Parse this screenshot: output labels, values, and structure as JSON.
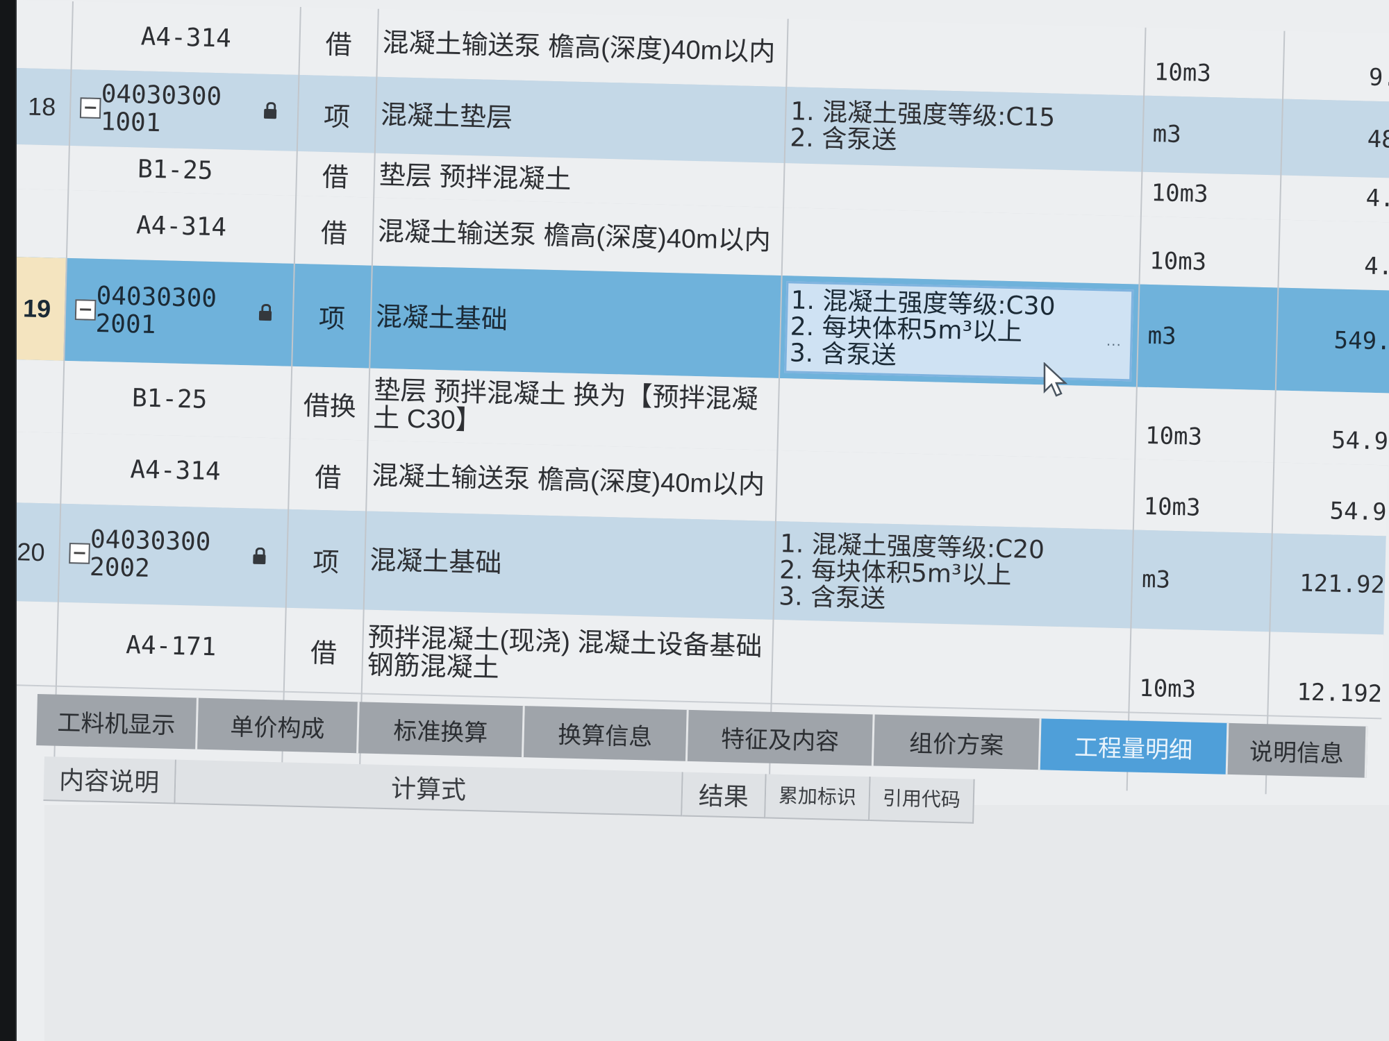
{
  "rows": [
    {
      "kind": "sub",
      "num": "",
      "code": "A4-314",
      "type": "借",
      "name": "混凝土输送泵 檐高(深度)40m以内",
      "features": "",
      "unit": "10m3",
      "qty": "9."
    },
    {
      "kind": "item",
      "num": "18",
      "code": "04030300\n1001",
      "type": "项",
      "name": "混凝土垫层",
      "features": "1. 混凝土强度等级:C15\n2. 含泵送",
      "unit": "m3",
      "qty": "48"
    },
    {
      "kind": "sub",
      "num": "",
      "code": "B1-25",
      "type": "借",
      "name": "垫层 预拌混凝土",
      "features": "",
      "unit": "10m3",
      "qty": "4."
    },
    {
      "kind": "sub",
      "num": "",
      "code": "A4-314",
      "type": "借",
      "name": "混凝土输送泵 檐高(深度)40m以内",
      "features": "",
      "unit": "10m3",
      "qty": "4."
    },
    {
      "kind": "sel",
      "num": "19",
      "code": "04030300\n2001",
      "type": "项",
      "name": "混凝土基础",
      "features": "1. 混凝土强度等级:C30\n2. 每块体积5m³以上\n3. 含泵送",
      "unit": "m3",
      "qty": "549."
    },
    {
      "kind": "sub",
      "num": "",
      "code": "B1-25",
      "type": "借换",
      "name": "垫层 预拌混凝土  换为【预拌混凝土 C30】",
      "features": "",
      "unit": "10m3",
      "qty": "54.9"
    },
    {
      "kind": "sub",
      "num": "",
      "code": "A4-314",
      "type": "借",
      "name": "混凝土输送泵 檐高(深度)40m以内",
      "features": "",
      "unit": "10m3",
      "qty": "54.9"
    },
    {
      "kind": "item",
      "num": "20",
      "code": "04030300\n2002",
      "type": "项",
      "name": "混凝土基础",
      "features": "1. 混凝土强度等级:C20\n2. 每块体积5m³以上\n3. 含泵送",
      "unit": "m3",
      "qty": "121.92"
    },
    {
      "kind": "sub",
      "num": "",
      "code": "A4-171",
      "type": "借",
      "name": "预拌混凝土(现浇) 混凝土设备基础 钢筋混凝土",
      "features": "",
      "unit": "10m3",
      "qty": "12.192"
    }
  ],
  "ellipsis": "···",
  "tabs": [
    "工料机显示",
    "单价构成",
    "标准换算",
    "换算信息",
    "特征及内容",
    "组价方案",
    "工程量明细",
    "说明信息"
  ],
  "active_tab": "工程量明细",
  "detail_headers": [
    "内容说明",
    "计算式",
    "结果",
    "累加标识",
    "引用代码"
  ]
}
